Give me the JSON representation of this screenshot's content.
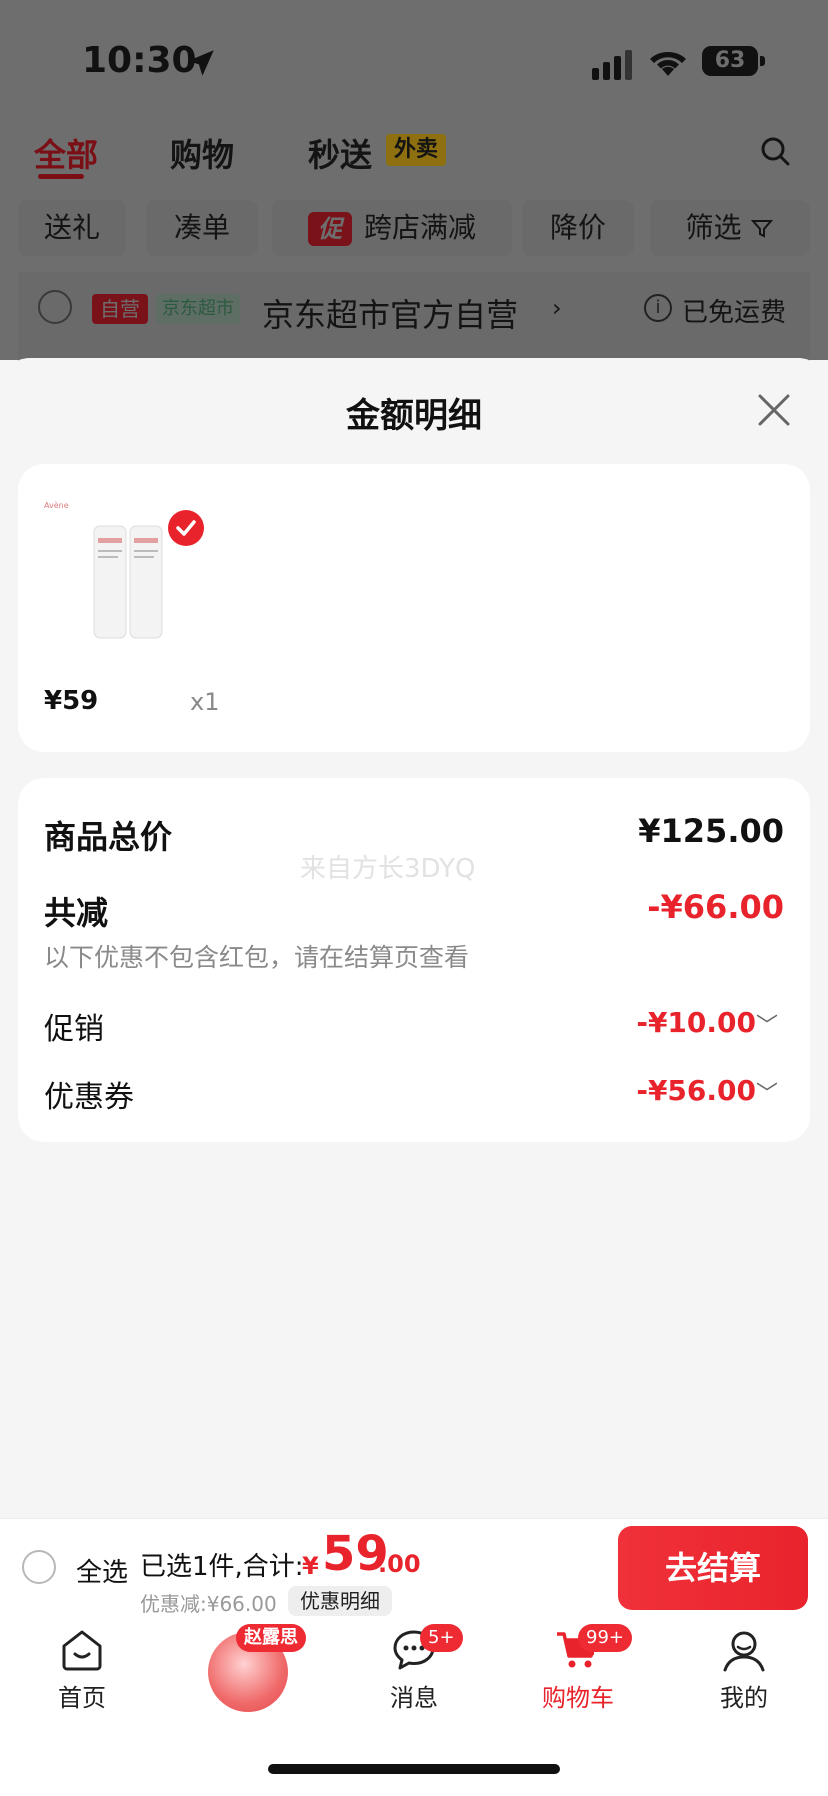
{
  "status_bar": {
    "time": "10:30",
    "battery": "63"
  },
  "background_page": {
    "tabs": [
      {
        "label": "全部",
        "active": true
      },
      {
        "label": "购物"
      },
      {
        "label": "秒送"
      }
    ],
    "tab_badge": "外卖",
    "filter_chips": [
      "送礼",
      "凑单",
      "跨店满减",
      "降价",
      "筛选"
    ],
    "promo_tag": "促",
    "store": {
      "tag_self": "自营",
      "tag_channel": "京东超市",
      "name": "京东超市官方自营",
      "chevron": "›",
      "shipping": "已免运费",
      "info_glyph": "i"
    }
  },
  "sheet": {
    "title": "金额明细",
    "item": {
      "price": "¥59",
      "quantity": "x1"
    },
    "summary": {
      "total_label": "商品总价",
      "total_value": "¥125.00",
      "watermark": "来自方长3DYQ",
      "reduction_label": "共减",
      "reduction_value": "-¥66.00",
      "note": "以下优惠不包含红包，请在结算页查看",
      "promo_label": "促销",
      "promo_value": "-¥10.00",
      "coupon_label": "优惠券",
      "coupon_value": "-¥56.00",
      "expand_glyph": "﹀"
    }
  },
  "checkout": {
    "select_all": "全选",
    "selected_info": "已选1件,合计:",
    "currency": "¥",
    "total_int": "59",
    "total_dec": ".00",
    "discount": "优惠减:¥66.00",
    "detail_button": "优惠明细",
    "pay_button": "去结算"
  },
  "tab_bar": {
    "home": "首页",
    "promo_badge": "赵露思",
    "messages": "消息",
    "messages_badge": "5+",
    "cart": "购物车",
    "cart_badge": "99+",
    "me": "我的"
  },
  "colors": {
    "accent": "#e9232c",
    "sheet_bg": "#f5f5f5",
    "card_bg": "#ffffff"
  }
}
